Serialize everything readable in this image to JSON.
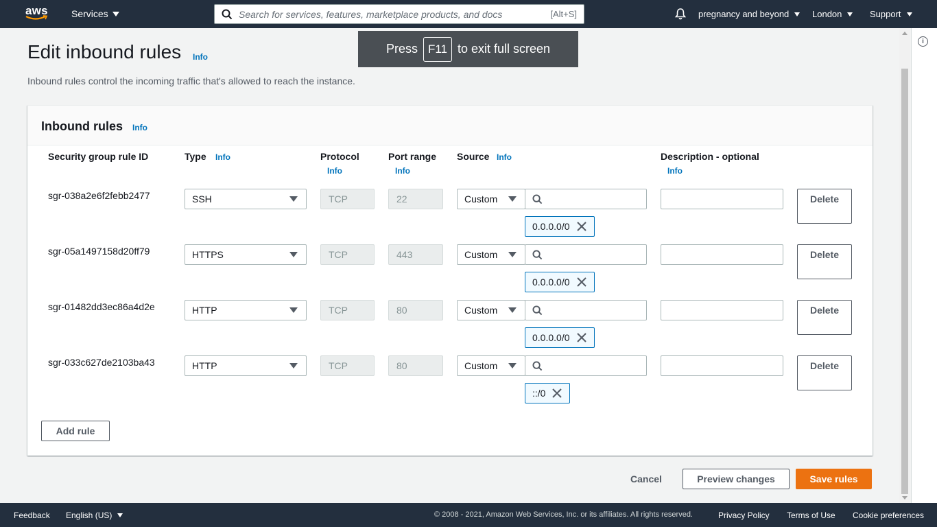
{
  "nav": {
    "logo_text": "aws",
    "services_label": "Services",
    "search_placeholder": "Search for services, features, marketplace products, and docs",
    "search_shortcut": "[Alt+S]",
    "account_label": "pregnancy and beyond",
    "region_label": "London",
    "support_label": "Support"
  },
  "fullscreen_toast": {
    "prefix": "Press",
    "key": "F11",
    "suffix": "to exit full screen"
  },
  "page": {
    "title": "Edit inbound rules",
    "title_info": "Info",
    "description": "Inbound rules control the incoming traffic that's allowed to reach the instance."
  },
  "container": {
    "title": "Inbound rules",
    "info": "Info"
  },
  "columns": {
    "rule_id": "Security group rule ID",
    "type": "Type",
    "type_info": "Info",
    "protocol": "Protocol",
    "protocol_info": "Info",
    "port_range": "Port range",
    "port_range_info": "Info",
    "source": "Source",
    "source_info": "Info",
    "description": "Description - optional",
    "description_info": "Info"
  },
  "rules": [
    {
      "id": "sgr-038a2e6f2febb2477",
      "type": "SSH",
      "protocol": "TCP",
      "port": "22",
      "source_type": "Custom",
      "source_token": "0.0.0.0/0",
      "description": "",
      "delete_label": "Delete"
    },
    {
      "id": "sgr-05a1497158d20ff79",
      "type": "HTTPS",
      "protocol": "TCP",
      "port": "443",
      "source_type": "Custom",
      "source_token": "0.0.0.0/0",
      "description": "",
      "delete_label": "Delete"
    },
    {
      "id": "sgr-01482dd3ec86a4d2e",
      "type": "HTTP",
      "protocol": "TCP",
      "port": "80",
      "source_type": "Custom",
      "source_token": "0.0.0.0/0",
      "description": "",
      "delete_label": "Delete"
    },
    {
      "id": "sgr-033c627de2103ba43",
      "type": "HTTP",
      "protocol": "TCP",
      "port": "80",
      "source_type": "Custom",
      "source_token": "::/0",
      "description": "",
      "delete_label": "Delete"
    }
  ],
  "actions": {
    "add_rule": "Add rule",
    "cancel": "Cancel",
    "preview": "Preview changes",
    "save": "Save rules"
  },
  "footer": {
    "feedback": "Feedback",
    "language": "English (US)",
    "copyright": "© 2008 - 2021, Amazon Web Services, Inc. or its affiliates. All rights reserved.",
    "privacy": "Privacy Policy",
    "terms": "Terms of Use",
    "cookies": "Cookie preferences"
  },
  "colors": {
    "nav_bg": "#232f3e",
    "accent_orange": "#ec7211",
    "link_blue": "#0073bb",
    "page_bg": "#f2f3f3"
  }
}
